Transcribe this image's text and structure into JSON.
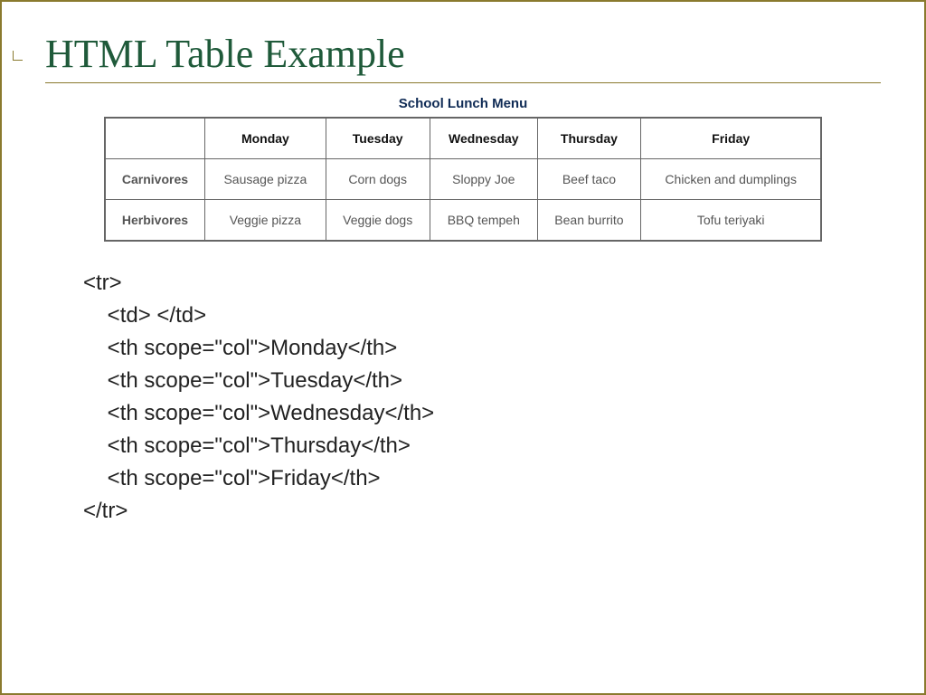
{
  "slide": {
    "title": "HTML Table Example"
  },
  "caption": "School Lunch Menu",
  "headers": {
    "blank": "",
    "c1": "Monday",
    "c2": "Tuesday",
    "c3": "Wednesday",
    "c4": "Thursday",
    "c5": "Friday"
  },
  "rows": [
    {
      "label": "Carnivores",
      "cells": [
        "Sausage pizza",
        "Corn dogs",
        "Sloppy Joe",
        "Beef taco",
        "Chicken and dumplings"
      ]
    },
    {
      "label": "Herbivores",
      "cells": [
        "Veggie pizza",
        "Veggie dogs",
        "BBQ tempeh",
        "Bean burrito",
        "Tofu teriyaki"
      ]
    }
  ],
  "code": {
    "l1": "<tr>",
    "l2": "    <td> </td>",
    "l3": "    <th scope=\"col\">Monday</th>",
    "l4": "    <th scope=\"col\">Tuesday</th>",
    "l5": "    <th scope=\"col\">Wednesday</th>",
    "l6": "    <th scope=\"col\">Thursday</th>",
    "l7": "    <th scope=\"col\">Friday</th>",
    "l8": "</tr>"
  }
}
